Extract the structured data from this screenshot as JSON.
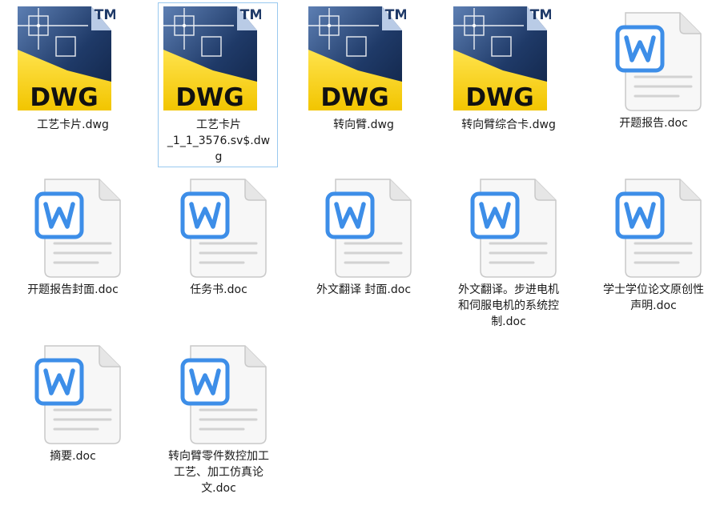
{
  "explorer": {
    "files": [
      {
        "name": "工艺卡片.dwg",
        "type": "dwg",
        "selected": false
      },
      {
        "name": "工艺卡片\n_1_1_3576.sv$.dw\ng",
        "type": "dwg",
        "selected": true
      },
      {
        "name": "转向臂.dwg",
        "type": "dwg",
        "selected": false
      },
      {
        "name": "转向臂综合卡.dwg",
        "type": "dwg",
        "selected": false
      },
      {
        "name": "开题报告.doc",
        "type": "doc",
        "selected": false
      },
      {
        "name": "开题报告封面.doc",
        "type": "doc",
        "selected": false
      },
      {
        "name": "任务书.doc",
        "type": "doc",
        "selected": false
      },
      {
        "name": "外文翻译 封面.doc",
        "type": "doc",
        "selected": false
      },
      {
        "name": "外文翻译。步进电机\n和伺服电机的系统控\n制.doc",
        "type": "doc",
        "selected": false
      },
      {
        "name": "学士学位论文原创性\n声明.doc",
        "type": "doc",
        "selected": false
      },
      {
        "name": "摘要.doc",
        "type": "doc",
        "selected": false
      },
      {
        "name": "转向臂零件数控加工\n工艺、加工仿真论\n文.doc",
        "type": "doc",
        "selected": false
      }
    ],
    "dwg_icon": {
      "label": "DWG",
      "trademark": "TM",
      "icon": "dwg-file-icon",
      "yellow": "#f2c500",
      "navy": "#1f3a68",
      "label_color": "#111111"
    },
    "doc_icon": {
      "letter": "W",
      "icon": "word-document-icon",
      "blue": "#3d8ee8",
      "page": "#f7f7f7",
      "border": "#c9c9c9"
    }
  }
}
